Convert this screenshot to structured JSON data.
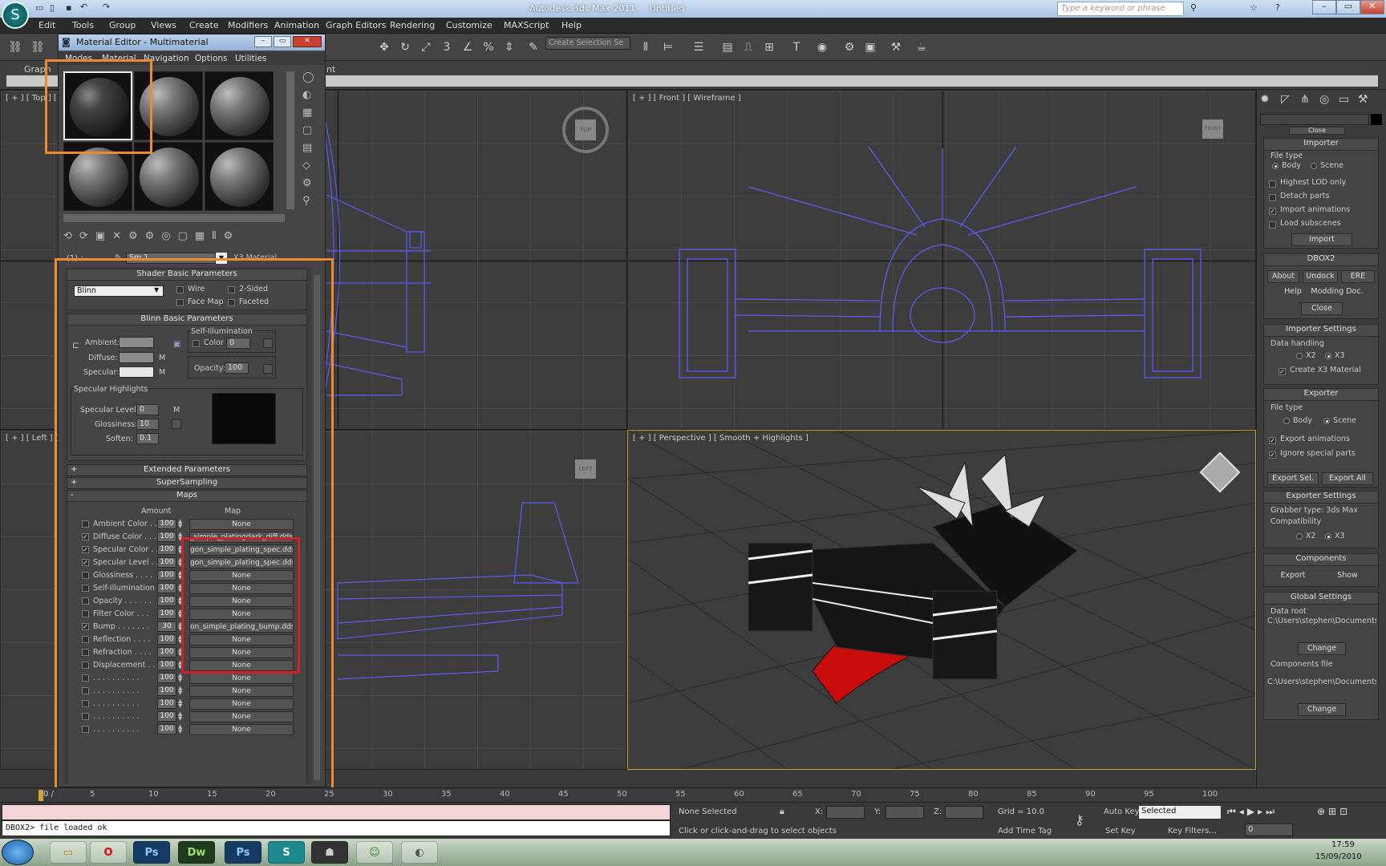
{
  "window": {
    "app_title": "Autodesk 3ds Max 2011",
    "doc_title": "Untitled",
    "search_placeholder": "Type a keyword or phrase"
  },
  "menu": [
    "Edit",
    "Tools",
    "Group",
    "Views",
    "Create",
    "Modifiers",
    "Animation",
    "Graph Editors",
    "Rendering",
    "Customize",
    "MAXScript",
    "Help"
  ],
  "toolbar": {
    "selection_set": "Create Selection Se"
  },
  "ribbon": {
    "tab1": "Graph",
    "tab2": "int"
  },
  "viewports": {
    "top": "[ + ] [ Top ] [ W",
    "front": "[ + ] [ Front ] [ Wireframe ]",
    "left": "[ + ] [ Left ] [ V",
    "perspective": "[ + ] [ Perspective ] [ Smooth + Highlights ]",
    "viewcube_top": "TOP",
    "viewcube_front": "FRONT",
    "viewcube_left": "LEFT"
  },
  "material_editor": {
    "title": "Material Editor - Multimaterial",
    "menu": [
      "Modes",
      "Material",
      "Navigation",
      "Options",
      "Utilities"
    ],
    "sub_id": "(1) :",
    "material_name": "Sm 1",
    "material_type": "X3 Material",
    "shader_basic": {
      "header": "Shader Basic Parameters",
      "shader": "Blinn",
      "wire": "Wire",
      "two_sided": "2-Sided",
      "face_map": "Face Map",
      "faceted": "Faceted"
    },
    "blinn": {
      "header": "Blinn Basic Parameters",
      "ambient": "Ambient:",
      "diffuse": "Diffuse:",
      "specular": "Specular:",
      "self_illum": "Self-Illumination",
      "color": "Color",
      "color_val": "0",
      "opacity": "Opacity:",
      "opacity_val": "100",
      "m": "M"
    },
    "spec": {
      "header": "Specular Highlights",
      "level": "Specular Level:",
      "level_val": "0",
      "gloss": "Glossiness:",
      "gloss_val": "10",
      "soften": "Soften:",
      "soften_val": "0.1"
    },
    "rollouts": {
      "extended": "Extended Parameters",
      "supersampling": "SuperSampling",
      "maps": "Maps"
    },
    "maps_cols": {
      "amount": "Amount",
      "map": "Map"
    },
    "maps": [
      {
        "name": "Ambient Color . .",
        "on": false,
        "amt": "100",
        "map": "None"
      },
      {
        "name": "Diffuse Color . . .",
        "on": true,
        "amt": "100",
        "map": "_simple_platingdark_diff.dds)"
      },
      {
        "name": "Specular Color . .",
        "on": true,
        "amt": "100",
        "map": "gon_simple_plating_spec.dds)"
      },
      {
        "name": "Specular Level . .",
        "on": true,
        "amt": "100",
        "map": "gon_simple_plating_spec.dds)"
      },
      {
        "name": "Glossiness . . . .",
        "on": false,
        "amt": "100",
        "map": "None"
      },
      {
        "name": "Self-Illumination .",
        "on": false,
        "amt": "100",
        "map": "None"
      },
      {
        "name": "Opacity . . . . . .",
        "on": false,
        "amt": "100",
        "map": "None"
      },
      {
        "name": "Filter Color . . .",
        "on": false,
        "amt": "100",
        "map": "None"
      },
      {
        "name": "Bump . . . . . . .",
        "on": true,
        "amt": "30",
        "map": "on_simple_plating_bump.dds)"
      },
      {
        "name": "Reflection . . . .",
        "on": false,
        "amt": "100",
        "map": "None"
      },
      {
        "name": "Refraction . . . .",
        "on": false,
        "amt": "100",
        "map": "None"
      },
      {
        "name": "Displacement . .",
        "on": false,
        "amt": "100",
        "map": "None"
      },
      {
        "name": ". . . . . . . . . .",
        "on": false,
        "amt": "100",
        "map": "None"
      },
      {
        "name": ". . . . . . . . . .",
        "on": false,
        "amt": "100",
        "map": "None"
      },
      {
        "name": ". . . . . . . . . .",
        "on": false,
        "amt": "100",
        "map": "None"
      },
      {
        "name": ". . . . . . . . . .",
        "on": false,
        "amt": "100",
        "map": "None"
      },
      {
        "name": ". . . . . . . . . .",
        "on": false,
        "amt": "100",
        "map": "None"
      }
    ]
  },
  "cmd": {
    "close_top": "Close",
    "importer": {
      "header": "Importer",
      "file_type": "File type",
      "body": "Body",
      "scene": "Scene",
      "highest_lod": "Highest LOD only",
      "detach": "Detach parts",
      "import_anim": "Import animations",
      "load_sub": "Load subscenes",
      "import_btn": "Import"
    },
    "dbox2": {
      "header": "DBOX2",
      "about": "About",
      "undock": "Undock",
      "ere": "ERE",
      "help": "Help",
      "modding": "Modding Doc.",
      "close": "Close"
    },
    "importer_settings": {
      "header": "Importer Settings",
      "data_handling": "Data handling",
      "x2": "X2",
      "x3": "X3",
      "create_mat": "Create X3 Material"
    },
    "exporter": {
      "header": "Exporter",
      "file_type": "File type",
      "body": "Body",
      "scene": "Scene",
      "export_anim": "Export animations",
      "ignore": "Ignore special parts",
      "export_sel": "Export Sel.",
      "export_all": "Export All"
    },
    "exporter_settings": {
      "header": "Exporter Settings",
      "grabber": "Grabber type: 3ds Max",
      "compat": "Compatibility",
      "x2": "X2",
      "x3": "X3"
    },
    "components": {
      "header": "Components",
      "export": "Export",
      "show": "Show"
    },
    "global": {
      "header": "Global Settings",
      "data_root": "Data root",
      "data_root_val": "C:\\Users\\stephen\\Documents\\",
      "change": "Change",
      "comp_file": "Components file",
      "comp_file_val": "C:\\Users\\stephen\\Documents\\",
      "change2": "Change"
    }
  },
  "timeline": {
    "frame": "0 /",
    "ticks": [
      "5",
      "10",
      "15",
      "20",
      "25",
      "30",
      "35",
      "40",
      "45",
      "50",
      "55",
      "60",
      "65",
      "70",
      "75",
      "80",
      "85",
      "90",
      "95",
      "100"
    ]
  },
  "status": {
    "console": "DBOX2> file loaded ok",
    "selection": "None Selected",
    "hint": "Click or click-and-drag to select objects",
    "x": "X:",
    "y": "Y:",
    "z": "Z:",
    "grid": "Grid = 10.0",
    "add_time_tag": "Add Time Tag",
    "auto_key": "Auto Key",
    "set_key": "Set Key",
    "selected": "Selected",
    "key_filters": "Key Filters...",
    "frame": "0"
  },
  "taskbar": {
    "time": "17:59",
    "date": "15/09/2010",
    "apps": [
      "Ps",
      "Dw",
      "Ps"
    ]
  }
}
